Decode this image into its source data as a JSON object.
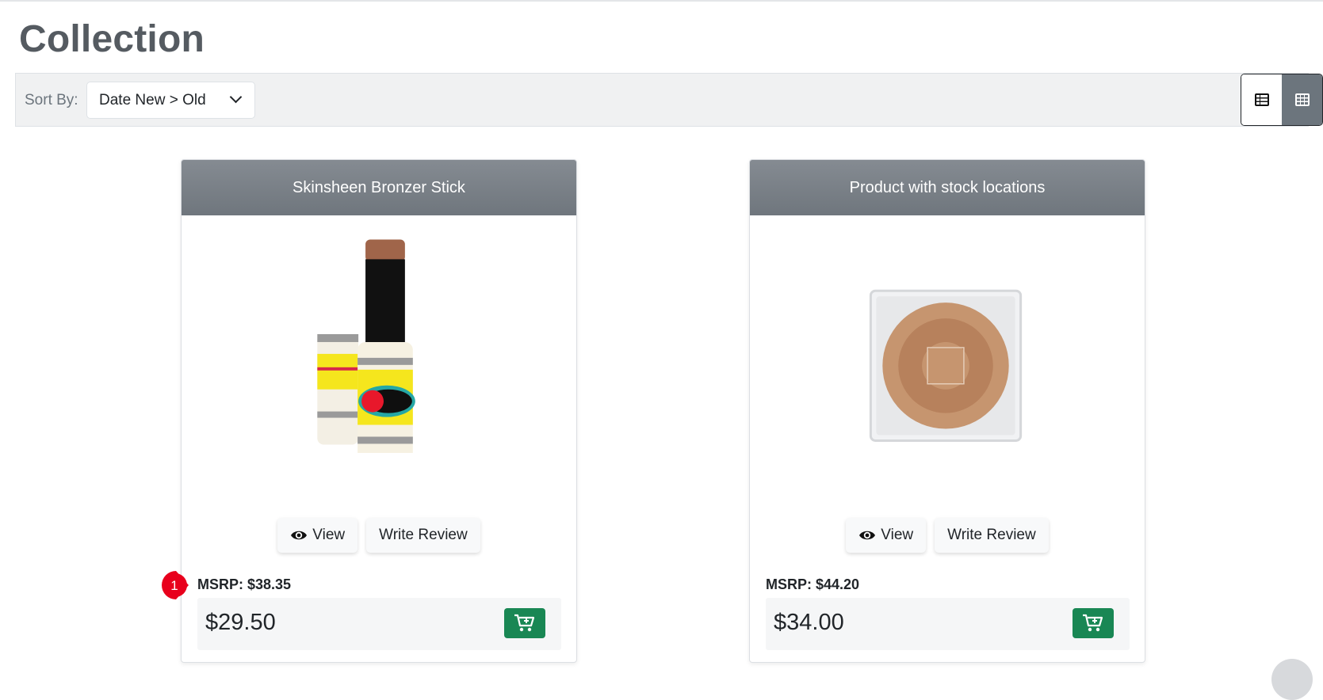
{
  "page": {
    "title": "Collection"
  },
  "toolbar": {
    "sort_label": "Sort By:",
    "sort_value": "Date New > Old",
    "view_modes": [
      {
        "name": "list",
        "icon": "list-view-icon",
        "active": false
      },
      {
        "name": "grid",
        "icon": "grid-view-icon",
        "active": true
      }
    ]
  },
  "products": [
    {
      "name": "Skinsheen Bronzer Stick",
      "msrp": "MSRP: $38.35",
      "price": "$29.50",
      "view_label": "View",
      "review_label": "Write Review",
      "image": "bronzer-stick-image"
    },
    {
      "name": "Product with stock locations",
      "msrp": "MSRP: $44.20",
      "price": "$34.00",
      "view_label": "View",
      "review_label": "Write Review",
      "image": "bronzer-compact-image"
    }
  ],
  "annotation": {
    "number": "1",
    "color": "#e8001c"
  },
  "colors": {
    "cart_button": "#198754",
    "card_header": "#7a8087",
    "active_toggle": "#6c757d"
  }
}
